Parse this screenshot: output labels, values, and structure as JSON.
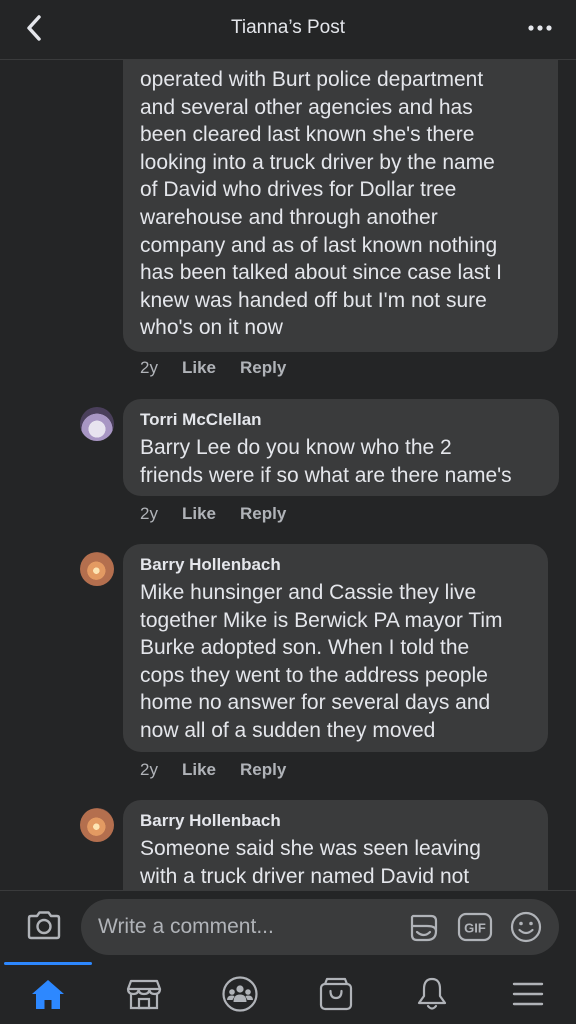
{
  "header": {
    "title": "Tianna’s Post"
  },
  "comments": [
    {
      "lines": [
        "operated with Burt police department",
        "and several other agencies and has",
        "been cleared last known she's there",
        "looking into a truck driver by the name",
        "of David who drives for Dollar tree",
        "warehouse and through another",
        "company and as of last known nothing",
        "has been talked about since case last I",
        "knew was handed off but I'm not sure",
        "who's on it now"
      ],
      "age": "2y",
      "like": "Like",
      "reply": "Reply"
    },
    {
      "author": "Torri McClellan",
      "lines": [
        "Barry Lee do you know who the 2",
        "friends were if so what are there name's"
      ],
      "age": "2y",
      "like": "Like",
      "reply": "Reply"
    },
    {
      "author": "Barry Hollenbach",
      "lines": [
        "Mike hunsinger and Cassie they live",
        "together Mike is Berwick PA mayor Tim",
        "Burke adopted son. When I told the",
        "cops they went to the address people",
        "home no answer for several days and",
        "now all of a sudden they moved"
      ],
      "age": "2y",
      "like": "Like",
      "reply": "Reply"
    },
    {
      "author": "Barry Hollenbach",
      "lines": [
        "Someone said she was seen leaving",
        "with a truck driver named David not"
      ]
    }
  ],
  "composer": {
    "placeholder": "Write a comment...",
    "gif_label": "GIF"
  },
  "tabs": [
    {
      "icon": "home-icon",
      "active": true
    },
    {
      "icon": "marketplace-icon",
      "active": false
    },
    {
      "icon": "groups-icon",
      "active": false
    },
    {
      "icon": "shop-icon",
      "active": false
    },
    {
      "icon": "bell-icon",
      "active": false
    },
    {
      "icon": "menu-icon",
      "active": false
    }
  ],
  "colors": {
    "background": "#242526",
    "bubble": "#3a3b3c",
    "text": "#e4e6eb",
    "secondary_text": "#b0b3b8",
    "accent": "#2d88ff"
  }
}
